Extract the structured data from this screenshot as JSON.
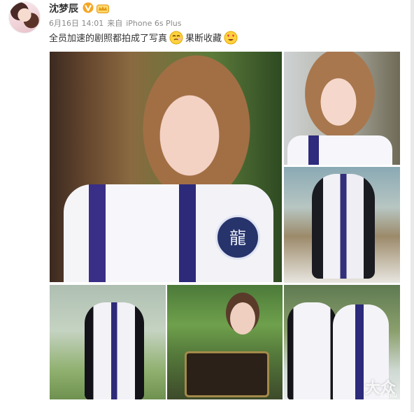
{
  "post": {
    "username": "沈梦辰",
    "date": "6月16日 14:01",
    "source_prefix": "来自",
    "source_device": "iPhone 6s Plus",
    "text_part1": "全员加速的剧照都拍成了写真",
    "text_part2": "果断收藏",
    "emoji_1": "smirk-emoji-icon",
    "emoji_2": "heart-eyes-emoji-icon"
  },
  "photos": {
    "main_badge_glyph": "龍",
    "watermark_text": "大众",
    "watermark_url": "kanlu"
  },
  "colors": {
    "vip_gold": "#f5a623",
    "text_primary": "#333333",
    "text_meta": "#8a8a8a",
    "robe_blue": "#2d2a7a"
  }
}
